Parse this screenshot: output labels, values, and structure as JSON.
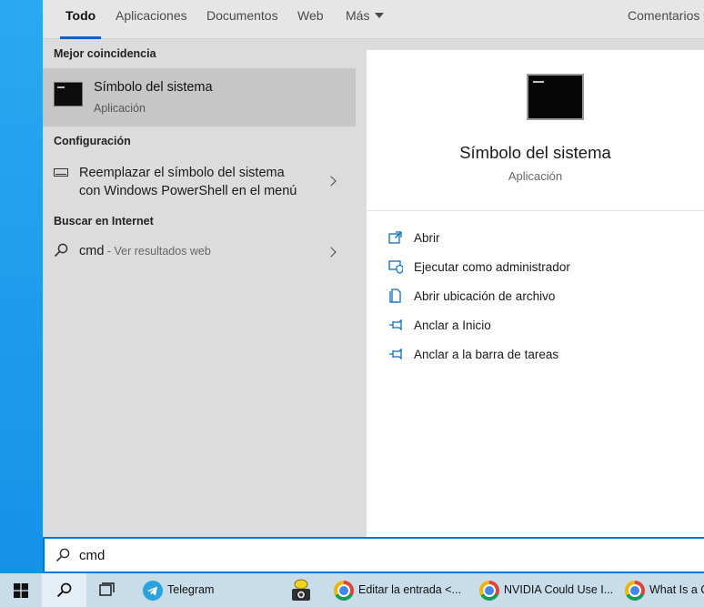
{
  "tabs": [
    {
      "label": "Todo",
      "active": true
    },
    {
      "label": "Aplicaciones"
    },
    {
      "label": "Documentos"
    },
    {
      "label": "Web"
    },
    {
      "label": "Más"
    }
  ],
  "tabs_right": "Comentarios",
  "results": {
    "best_match_title": "Mejor coincidencia",
    "best_match": {
      "name": "Símbolo del sistema",
      "type": "Aplicación"
    },
    "settings_title": "Configuración",
    "setting_line1": "Reemplazar el símbolo del sistema",
    "setting_line2": "con Windows PowerShell en el menú",
    "web_title": "Buscar en Internet",
    "web_query": "cmd",
    "web_suffix": " - Ver resultados web"
  },
  "preview": {
    "title": "Símbolo del sistema",
    "subtitle": "Aplicación",
    "actions": [
      "Abrir",
      "Ejecutar como administrador",
      "Abrir ubicación de archivo",
      "Anclar a Inicio",
      "Anclar a la barra de tareas"
    ]
  },
  "search": {
    "value": "cmd"
  },
  "taskbar": {
    "items": [
      "Telegram",
      "Editar la entrada <...",
      "NVIDIA Could Use I...",
      "What Is a C"
    ]
  },
  "colors": {
    "accent": "#0078d7",
    "tab_indicator": "#0a64c8",
    "icon_blue": "#0a6fc2"
  }
}
